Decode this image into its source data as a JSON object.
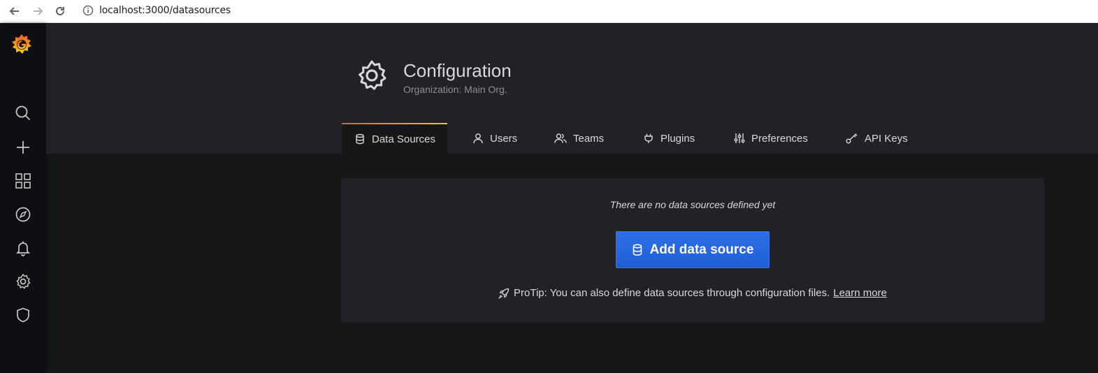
{
  "browser": {
    "url": "localhost:3000/datasources"
  },
  "sidebar": {
    "items": [
      {
        "icon": "search-icon"
      },
      {
        "icon": "plus-icon"
      },
      {
        "icon": "dashboards-grid-icon"
      },
      {
        "icon": "compass-icon"
      },
      {
        "icon": "bell-icon"
      },
      {
        "icon": "gear-icon"
      },
      {
        "icon": "shield-icon"
      }
    ]
  },
  "header": {
    "title": "Configuration",
    "subtitle": "Organization: Main Org."
  },
  "tabs": [
    {
      "label": "Data Sources",
      "icon": "database-icon",
      "active": true
    },
    {
      "label": "Users",
      "icon": "user-icon"
    },
    {
      "label": "Teams",
      "icon": "users-icon"
    },
    {
      "label": "Plugins",
      "icon": "plug-icon"
    },
    {
      "label": "Preferences",
      "icon": "sliders-icon"
    },
    {
      "label": "API Keys",
      "icon": "key-icon"
    }
  ],
  "empty_state": {
    "message": "There are no data sources defined yet",
    "button_label": "Add data source",
    "protip_text": "ProTip: You can also define data sources through configuration files.",
    "protip_link": "Learn more"
  },
  "colors": {
    "background": "#161719",
    "sidebar": "#0e0f12",
    "header": "#202226",
    "card": "#212226",
    "primary_button": "#1f62e0",
    "tab_accent_start": "#f05a28",
    "tab_accent_end": "#fbca0a"
  }
}
